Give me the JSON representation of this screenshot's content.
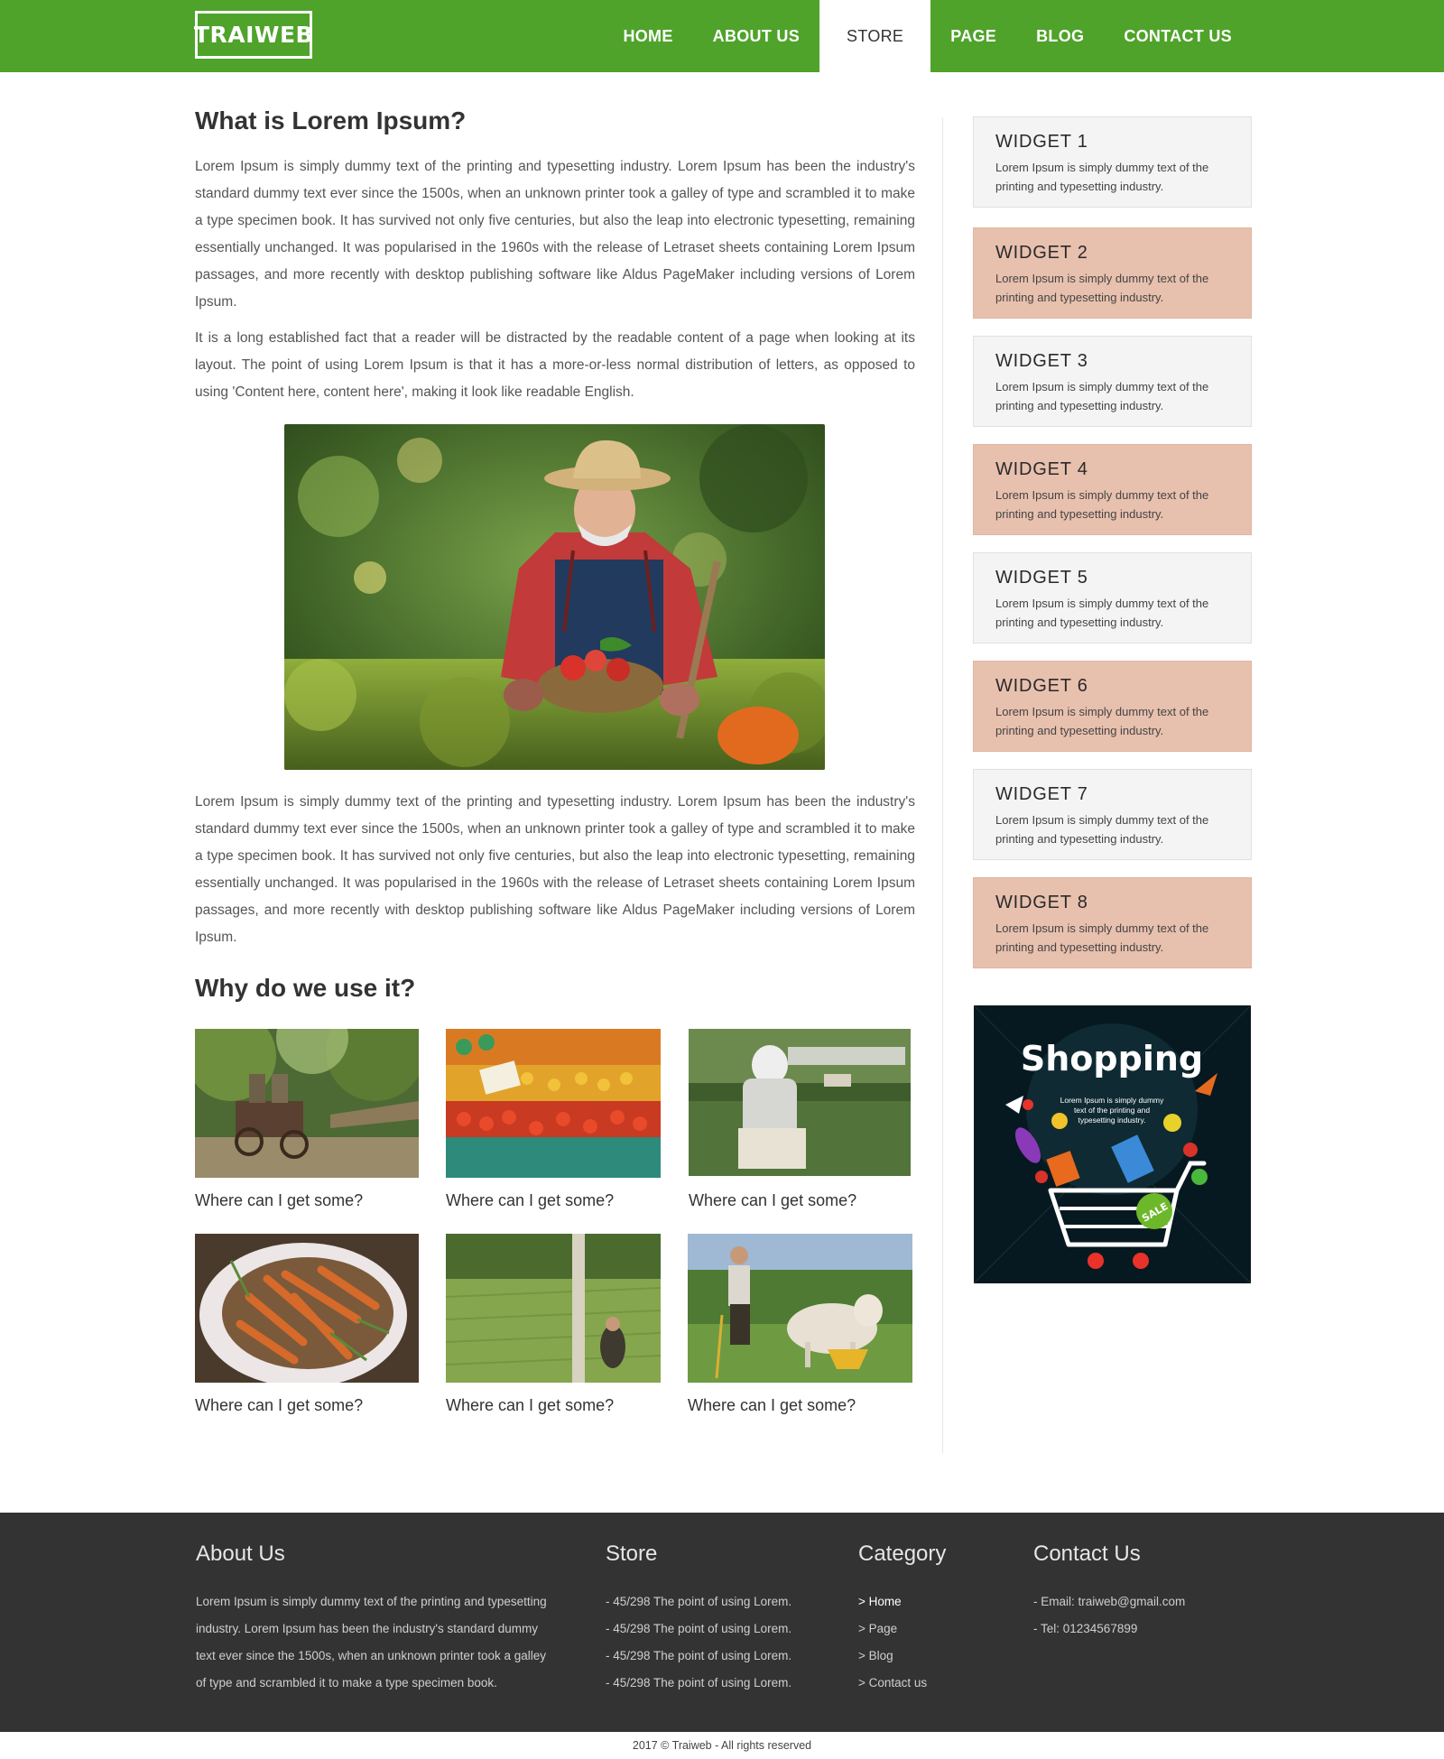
{
  "header": {
    "logo": "TRAIWEB",
    "nav": [
      "HOME",
      "ABOUT US",
      "STORE",
      "PAGE",
      "BLOG",
      "CONTACT US"
    ],
    "active": "STORE"
  },
  "main": {
    "title1": "What is Lorem Ipsum?",
    "p1": "Lorem Ipsum is simply dummy text of the printing and typesetting industry. Lorem Ipsum has been the industry's standard dummy text ever since the 1500s, when an unknown printer took a galley of type and scrambled it to make a type specimen book. It has survived not only five centuries, but also the leap into electronic typesetting, remaining essentially unchanged. It was popularised in the 1960s with the release of Letraset sheets containing Lorem Ipsum passages, and more recently with desktop publishing software like Aldus PageMaker including versions of Lorem Ipsum.",
    "p2": "It is a long established fact that a reader will be distracted by the readable content of a page when looking at its layout. The point of using Lorem Ipsum is that it has a more-or-less normal distribution of letters, as opposed to using 'Content here, content here', making it look like readable English.",
    "p3": "Lorem Ipsum is simply dummy text of the printing and typesetting industry. Lorem Ipsum has been the industry's standard dummy text ever since the 1500s, when an unknown printer took a galley of type and scrambled it to make a type specimen book. It has survived not only five centuries, but also the leap into electronic typesetting, remaining essentially unchanged. It was popularised in the 1960s with the release of Letraset sheets containing Lorem Ipsum passages, and more recently with desktop publishing software like Aldus PageMaker including versions of Lorem Ipsum.",
    "title2": "Why do we use it?",
    "gallery": [
      {
        "caption": "Where can I get some?"
      },
      {
        "caption": "Where can I get some?"
      },
      {
        "caption": "Where can I get some?"
      },
      {
        "caption": "Where can I get some?"
      },
      {
        "caption": "Where can I get some?"
      },
      {
        "caption": "Where can I get some?"
      }
    ]
  },
  "sidebar": {
    "widgets": [
      {
        "title": "WIDGET 1",
        "text": "Lorem Ipsum is simply dummy text of the printing and typesetting industry."
      },
      {
        "title": "WIDGET 2",
        "text": "Lorem Ipsum is simply dummy text of the printing and typesetting industry."
      },
      {
        "title": "WIDGET 3",
        "text": "Lorem Ipsum is simply dummy text of the printing and typesetting industry."
      },
      {
        "title": "WIDGET 4",
        "text": "Lorem Ipsum is simply dummy text of the printing and typesetting industry."
      },
      {
        "title": "WIDGET 5",
        "text": "Lorem Ipsum is simply dummy text of the printing and typesetting industry."
      },
      {
        "title": "WIDGET 6",
        "text": "Lorem Ipsum is simply dummy text of the printing and typesetting industry."
      },
      {
        "title": "WIDGET 7",
        "text": "Lorem Ipsum is simply dummy text of the printing and typesetting industry."
      },
      {
        "title": "WIDGET 8",
        "text": "Lorem Ipsum is simply dummy text of the printing and typesetting industry."
      }
    ],
    "ad": {
      "title": "Shopping",
      "text1": "Lorem Ipsum is simply dummy",
      "text2": "text of the printing and",
      "text3": "typesetting industry.",
      "badge": "SALE"
    }
  },
  "footer": {
    "about_title": "About Us",
    "about_text": "Lorem Ipsum is simply dummy text of the printing and typesetting industry. Lorem Ipsum has been the industry's standard dummy text ever since the 1500s, when an unknown printer took a galley of type and scrambled it to make a type specimen book.",
    "store_title": "Store",
    "store_items": [
      "- 45/298 The point of using Lorem.",
      "- 45/298 The point of using Lorem.",
      "- 45/298 The point of using Lorem.",
      "- 45/298 The point of using Lorem."
    ],
    "category_title": "Category",
    "category_items": [
      "Home",
      "Page",
      "Blog",
      "Contact us"
    ],
    "contact_title": "Contact Us",
    "contact_email": "- Email: traiweb@gmail.com",
    "contact_tel": "- Tel: 01234567899",
    "copyright": "2017 © Traiweb - All rights reserved"
  },
  "colors": {
    "brand_green": "#4fa32a",
    "widget_gray": "#f4f4f4",
    "widget_peach": "#e8c0ae",
    "footer_bg": "#333333"
  }
}
